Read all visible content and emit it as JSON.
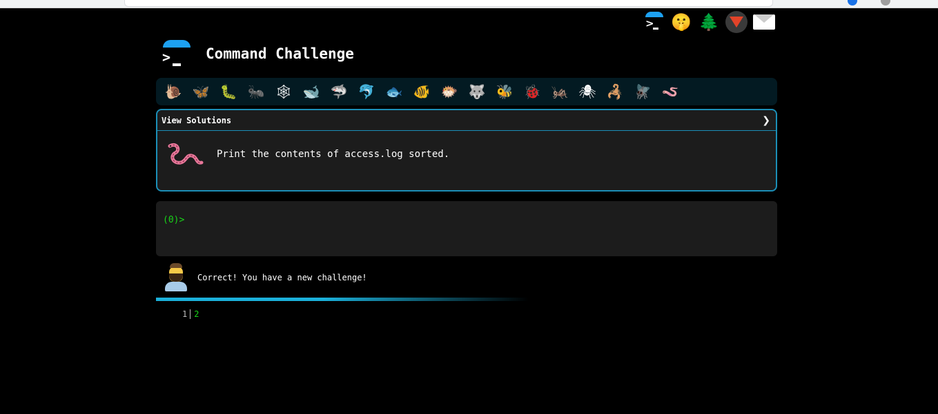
{
  "top_icons": [
    "command-prompt-icon",
    "shushing-face-icon",
    "evergreen-tree-icon",
    "gitlab-icon",
    "envelope-icon"
  ],
  "header": {
    "title": "Command Challenge"
  },
  "creatures": [
    {
      "name": "snail",
      "glyph": "🐌"
    },
    {
      "name": "butterfly",
      "glyph": "🦋"
    },
    {
      "name": "caterpillar",
      "glyph": "🐛"
    },
    {
      "name": "ant",
      "glyph": "🐜"
    },
    {
      "name": "spider-web",
      "glyph": "🕸"
    },
    {
      "name": "whale",
      "glyph": "🐋"
    },
    {
      "name": "shark",
      "glyph": "🦈"
    },
    {
      "name": "dolphin",
      "glyph": "🐬"
    },
    {
      "name": "fish",
      "glyph": "🐟"
    },
    {
      "name": "tropical-fish",
      "glyph": "🐠"
    },
    {
      "name": "blowfish",
      "glyph": "🐡"
    },
    {
      "name": "wolf",
      "glyph": "🐺"
    },
    {
      "name": "bee",
      "glyph": "🐝"
    },
    {
      "name": "ladybug",
      "glyph": "🐞"
    },
    {
      "name": "cricket",
      "glyph": "🦗"
    },
    {
      "name": "spider",
      "glyph": "🕷"
    },
    {
      "name": "scorpion",
      "glyph": "🦂"
    },
    {
      "name": "fly",
      "glyph": "🪰"
    },
    {
      "name": "worm",
      "glyph": "🪱"
    }
  ],
  "challenge": {
    "solutions_label": "View Solutions",
    "text": "Print the contents of access.log sorted."
  },
  "terminal": {
    "prompt": "(0)>"
  },
  "result": {
    "message": "Correct! You have a new challenge!"
  },
  "progress": {
    "fraction": 0.4
  },
  "lines": {
    "previous": "1",
    "current": "2"
  },
  "colors": {
    "accent": "#1b8fb8",
    "prompt_green": "#19d419",
    "panel_bg": "#1c1c1c"
  }
}
